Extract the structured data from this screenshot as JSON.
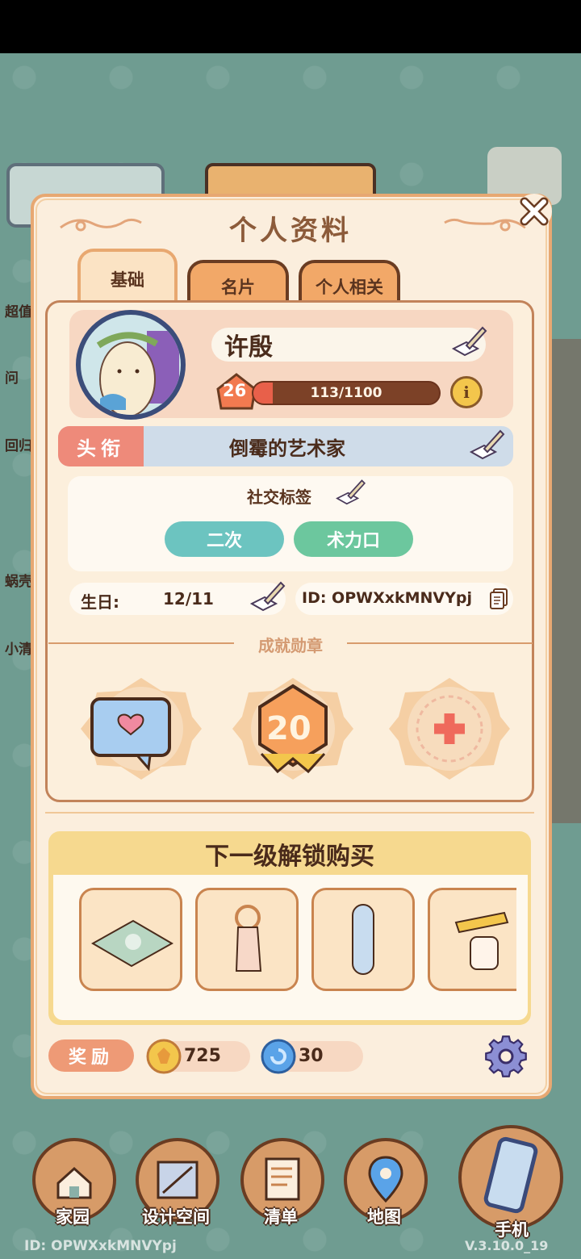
{
  "panel": {
    "title": "个人资料",
    "close_icon": "close-icon"
  },
  "tabs": [
    {
      "label": "基础",
      "active": true
    },
    {
      "label": "名片",
      "active": false
    },
    {
      "label": "个人相关",
      "active": false
    }
  ],
  "profile": {
    "name": "许殷",
    "level": "26",
    "xp_text": "113/1100",
    "xp_fraction": 0.103,
    "honor_label": "头衔",
    "honor_value": "倒霉的艺术家",
    "social_label": "社交标签",
    "social_tags": [
      "二次",
      "术力口"
    ],
    "birthday_label": "生日:",
    "birthday_value": "12/11",
    "id_text": "ID: OPWXxkMNVYpj"
  },
  "achievements": {
    "title": "成就勋章",
    "badges": [
      {
        "icon": "heart-message-badge-icon"
      },
      {
        "icon": "level-20-badge-icon",
        "value": "20"
      },
      {
        "icon": "add-badge-icon"
      }
    ]
  },
  "unlock": {
    "title": "下一级解锁购买",
    "items": [
      "rug-item-icon",
      "towel-ring-item-icon",
      "mirror-item-icon",
      "toilet-paper-holder-item-icon"
    ]
  },
  "rewards": {
    "label": "奖励",
    "coin_value": "725",
    "gem_value": "30"
  },
  "side_labels": [
    "超值",
    "问",
    "回归",
    "蜗壳",
    "小清"
  ],
  "nav": [
    {
      "label": "家园",
      "icon": "home-icon"
    },
    {
      "label": "设计空间",
      "icon": "design-space-icon"
    },
    {
      "label": "清单",
      "icon": "checklist-icon"
    },
    {
      "label": "地图",
      "icon": "map-pin-icon"
    },
    {
      "label": "手机",
      "icon": "phone-icon"
    }
  ],
  "footer": {
    "id": "ID: OPWXxkMNVYpj",
    "version": "V.3.10.0_19"
  },
  "colors": {
    "background": "#6f9c91",
    "panel": "#fbeedd",
    "accent_orange": "#f2a868",
    "tag_teal": "#6cc4c0",
    "tag_green": "#6cc79e",
    "xp_fill": "#e8604a"
  }
}
